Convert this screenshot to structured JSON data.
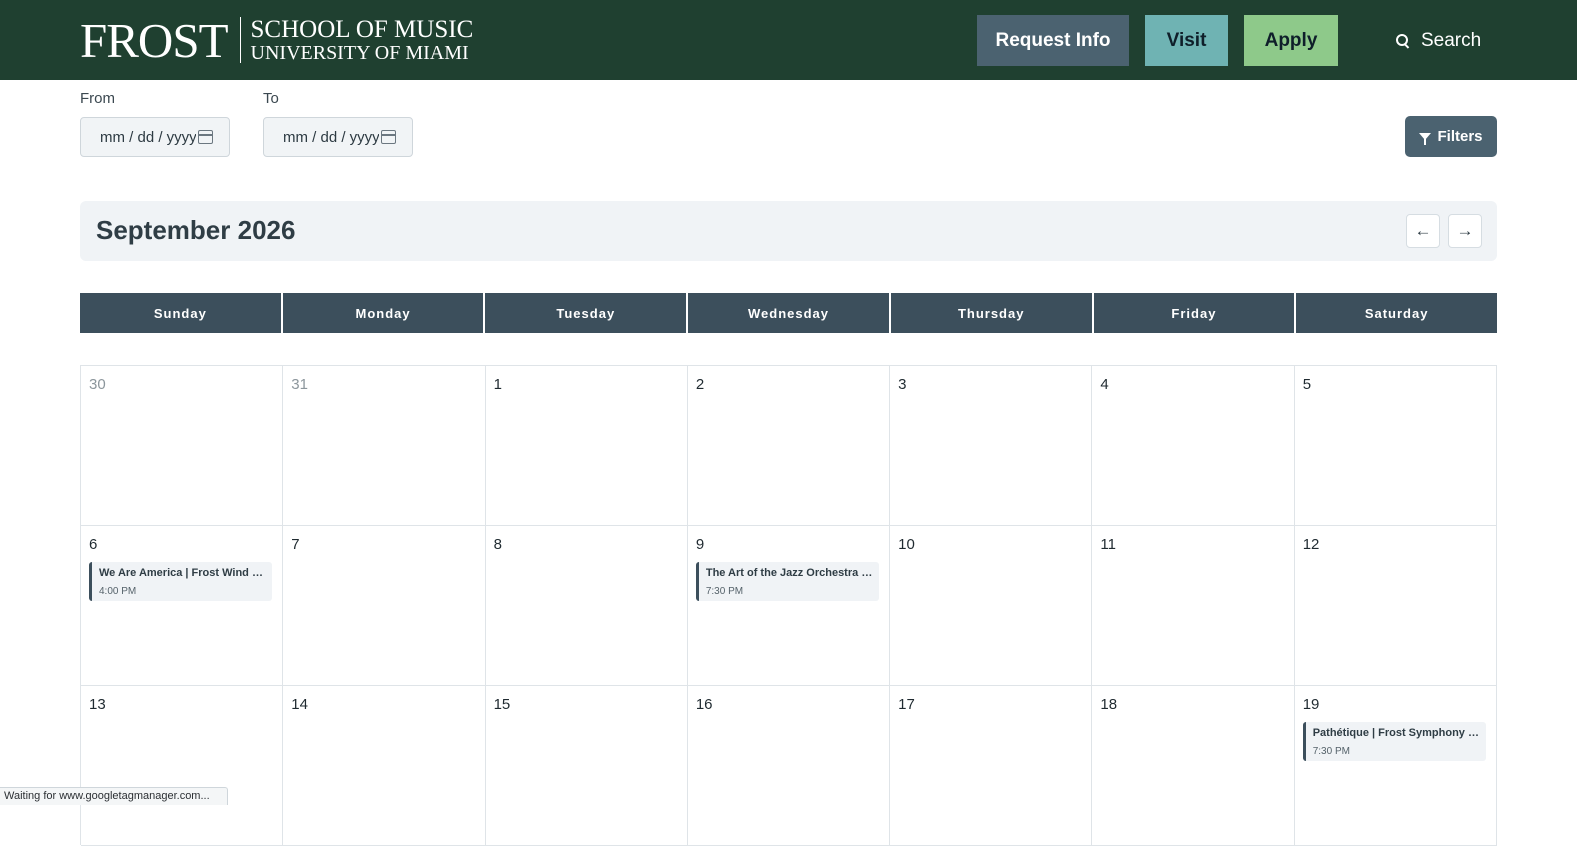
{
  "header": {
    "logo_main": "FROST",
    "logo_line1": "SCHOOL OF MUSIC",
    "logo_line2": "UNIVERSITY OF MIAMI",
    "request_info": "Request Info",
    "visit": "Visit",
    "apply": "Apply",
    "search": "Search",
    "colors": {
      "bar": "#1f4030",
      "request": "#4b6270",
      "visit": "#6fb3b3",
      "apply": "#8ec98a"
    }
  },
  "filters": {
    "from_label": "From",
    "to_label": "To",
    "from_value": "mm / dd / yyyy",
    "to_value": "mm / dd / yyyy",
    "filters_button": "Filters"
  },
  "calendar": {
    "month_title": "September 2026",
    "prev_icon": "←",
    "next_icon": "→",
    "weekdays": [
      "Sunday",
      "Monday",
      "Tuesday",
      "Wednesday",
      "Thursday",
      "Friday",
      "Saturday"
    ],
    "weeks": [
      [
        {
          "day": "30",
          "muted": true
        },
        {
          "day": "31",
          "muted": true
        },
        {
          "day": "1"
        },
        {
          "day": "2"
        },
        {
          "day": "3"
        },
        {
          "day": "4"
        },
        {
          "day": "5"
        }
      ],
      [
        {
          "day": "6",
          "event": {
            "title": "We Are America | Frost Wind Ensemble",
            "time": "4:00 PM"
          }
        },
        {
          "day": "7"
        },
        {
          "day": "8"
        },
        {
          "day": "9",
          "event": {
            "title": "The Art of the Jazz Orchestra | Frost Concert Jazz Band",
            "time": "7:30 PM"
          }
        },
        {
          "day": "10"
        },
        {
          "day": "11"
        },
        {
          "day": "12"
        }
      ],
      [
        {
          "day": "13"
        },
        {
          "day": "14"
        },
        {
          "day": "15"
        },
        {
          "day": "16"
        },
        {
          "day": "17"
        },
        {
          "day": "18"
        },
        {
          "day": "19",
          "event": {
            "title": "Pathétique | Frost Symphony Orchestra",
            "time": "7:30 PM"
          }
        }
      ]
    ]
  },
  "status_bar": "Waiting for www.googletagmanager.com..."
}
